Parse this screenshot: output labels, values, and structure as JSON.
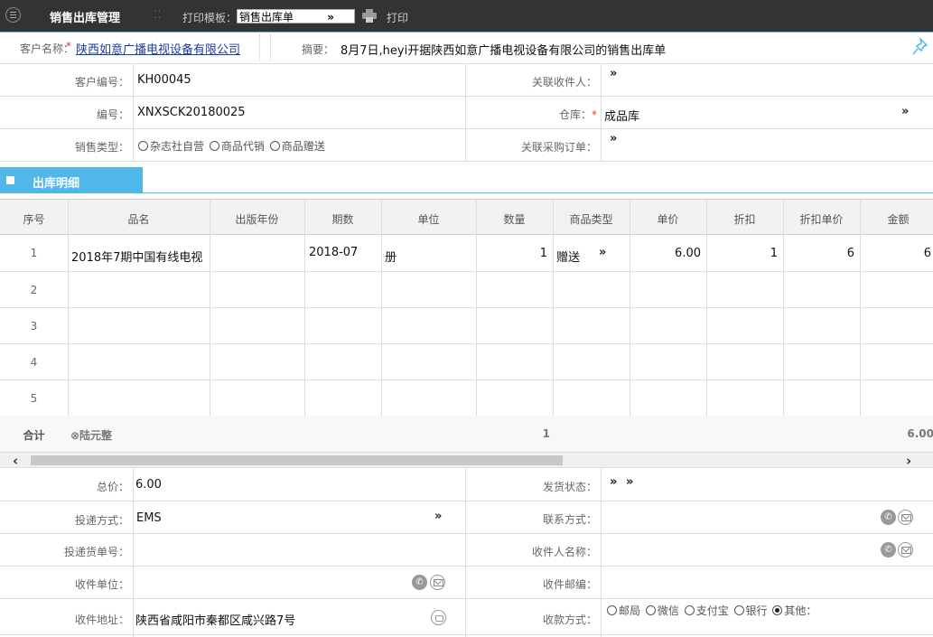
{
  "toolbar": {
    "title": "销售出库管理",
    "print_template_label": "打印模板：",
    "print_template_value": "销售出库单",
    "print_label": "打印"
  },
  "header": {
    "customer_name_label": "客户名称：",
    "customer_name_value": "陕西如意广播电视设备有限公司",
    "summary_label": "摘要：",
    "summary_value": "8月7日,heyi开据陕西如意广播电视设备有限公司的销售出库单"
  },
  "form": {
    "customer_code_label": "客户编号：",
    "customer_code_value": "KH00045",
    "related_receiver_label": "关联收件人：",
    "number_label": "编号：",
    "number_value": "XNXSCK20180025",
    "warehouse_label": "仓库：",
    "warehouse_value": "成品库",
    "sale_type_label": "销售类型：",
    "sale_type_options": [
      "杂志社自营",
      "商品代销",
      "商品赠送"
    ],
    "related_po_label": "关联采购订单："
  },
  "section": {
    "title": "出库明细"
  },
  "table": {
    "columns": [
      "序号",
      "品名",
      "出版年份",
      "期数",
      "单位",
      "数量",
      "商品类型",
      "单价",
      "折扣",
      "折扣单价",
      "金额"
    ],
    "rows": [
      {
        "no": "1",
        "name": "2018年7期中国有线电视",
        "year": "",
        "issue": "2018-07",
        "unit": "册",
        "qty": "1",
        "type": "赠送",
        "price": "6.00",
        "discount": "1",
        "disc_price": "6",
        "amount": "6"
      },
      {
        "no": "2"
      },
      {
        "no": "3"
      },
      {
        "no": "4"
      },
      {
        "no": "5"
      }
    ],
    "footer": {
      "label": "合计",
      "amount_words": "⊗陆元整",
      "qty_total": "1",
      "amount_total": "6.00"
    }
  },
  "bottom": {
    "total_price_label": "总价：",
    "total_price_value": "6.00",
    "ship_status_label": "发货状态：",
    "delivery_method_label": "投递方式：",
    "delivery_method_value": "EMS",
    "contact_method_label": "联系方式：",
    "tracking_no_label": "投递货单号：",
    "receiver_name_label": "收件人名称：",
    "receiver_unit_label": "收件单位：",
    "postcode_label": "收件邮编：",
    "address_label": "收件地址：",
    "address_value": "陕西省咸阳市秦都区咸兴路7号",
    "payment_label": "收款方式：",
    "payment_options": [
      "邮局",
      "微信",
      "支付宝",
      "银行",
      "其他："
    ],
    "payment_selected": "其他："
  },
  "icons": {
    "menu": "menu-circle-icon",
    "print": "printer-icon",
    "pin": "pushpin-icon",
    "phone": "phone-icon",
    "mail": "mail-icon",
    "location": "location-icon"
  },
  "colors": {
    "toolbar_bg": "#333333",
    "accent": "#4fb8e8",
    "link": "#1a3c9a",
    "required": "#ee3333"
  }
}
